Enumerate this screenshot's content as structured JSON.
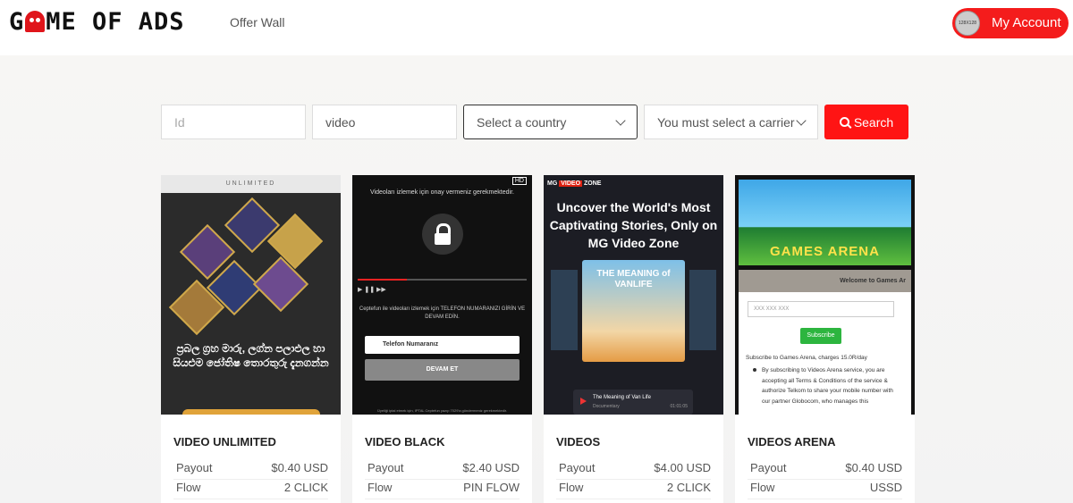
{
  "header": {
    "logo_text": "GAME OF ADS",
    "nav_link": "Offer Wall",
    "account": {
      "avatar_text": "128X128",
      "label": "My Account"
    }
  },
  "search": {
    "id_placeholder": "Id",
    "keyword_value": "video",
    "country_placeholder": "Select a country",
    "carrier_placeholder": "You must select a carrier",
    "button_label": "Search"
  },
  "offers": [
    {
      "title": "VIDEO UNLIMITED",
      "payout_label": "Payout",
      "payout": "$0.40 USD",
      "flow_label": "Flow",
      "flow": "2 CLICK",
      "thumb": {
        "top_text": "UNLIMITED",
        "body_text": "ප්‍රබල ග්‍රහ මාරු, ලග්න පලාඵල හා සියළුම ජෝතිෂ තොරතුරු දැනගන්න"
      }
    },
    {
      "title": "VIDEO BLACK",
      "payout_label": "Payout",
      "payout": "$2.40 USD",
      "flow_label": "Flow",
      "flow": "PIN FLOW",
      "thumb": {
        "hd": "HD",
        "message": "Videoları izlemek için onay vermeniz gerekmektedir.",
        "controls": "▶ ❚❚ ▶▶",
        "description": "Ceptefun ile videoları izlemek için TELEFON NUMARANIZI GİRİN VE DEVAM EDİN.",
        "phone_placeholder": "Telefon Numaranız",
        "button": "DEVAM ET",
        "footer": "Üyeliği iptal etmek için, IPTAL Ceptefun yazıp 7029'a göndermeniz gerekmektedir."
      }
    },
    {
      "title": "VIDEOS",
      "payout_label": "Payout",
      "payout": "$4.00 USD",
      "flow_label": "Flow",
      "flow": "2 CLICK",
      "thumb": {
        "brand_a": "MG",
        "brand_b": "VIDEO",
        "brand_c": "ZONE",
        "headline": "Uncover the World's Most Captivating Stories, Only on MG Video Zone",
        "poster": "THE MEANING of VANLIFE",
        "track_title": "The Meaning of Van Life",
        "track_sub": "Documentary",
        "track_time": "01:01:05"
      }
    },
    {
      "title": "VIDEOS ARENA",
      "payout_label": "Payout",
      "payout": "$0.40 USD",
      "flow_label": "Flow",
      "flow": "USSD",
      "thumb": {
        "banner": "GAMES ARENA",
        "panel_header": "Welcome to Games Ar",
        "input_placeholder": "XXX XXX XXX",
        "subscribe": "Subscribe",
        "line1": "Subscribe to Games Arena, charges 15.0R/day",
        "line2": "By subscribing to Videos Arena service, you are accepting all Terms & Conditions of the service & authorize Telkom to share your mobile number with our partner Globocom, who manages this"
      }
    }
  ],
  "colors": {
    "accent": "#ff1414",
    "account_button": "#f41c1c"
  }
}
